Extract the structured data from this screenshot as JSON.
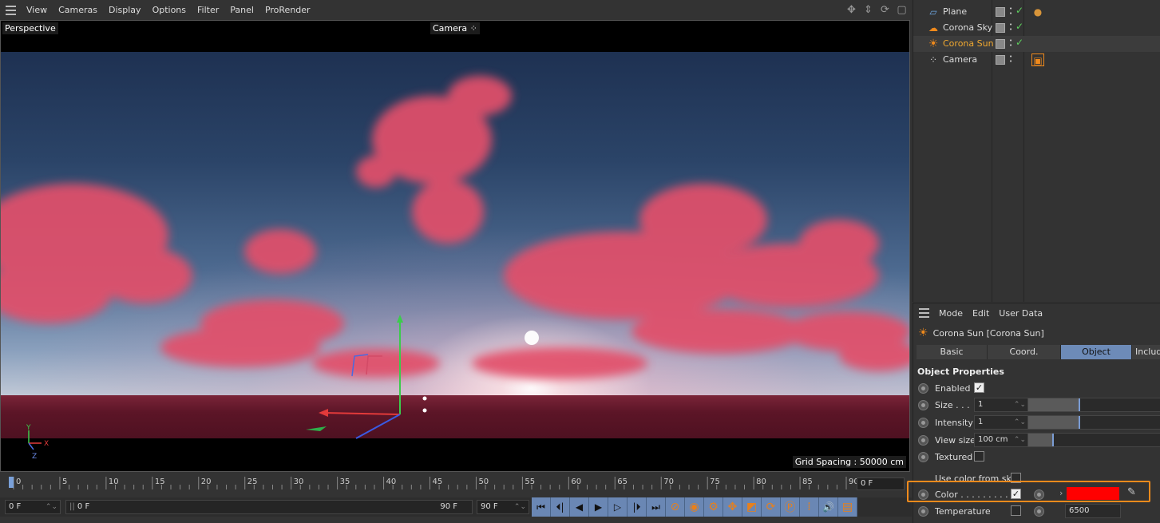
{
  "viewport": {
    "menu": [
      "View",
      "Cameras",
      "Display",
      "Options",
      "Filter",
      "Panel",
      "ProRender"
    ],
    "view_label": "Perspective",
    "camera_label": "Camera",
    "grid_spacing": "Grid Spacing : 50000 cm",
    "axis_labels": {
      "y": "Y",
      "x": "X",
      "z": "Z"
    }
  },
  "timeline": {
    "ticks": [
      "0",
      "5",
      "10",
      "15",
      "20",
      "25",
      "30",
      "35",
      "40",
      "45",
      "50",
      "55",
      "60",
      "65",
      "70",
      "75",
      "80",
      "85",
      "90"
    ],
    "current_frame": "0 F",
    "start_frame": "0 F",
    "range_start": "0 F",
    "range_end": "90 F",
    "end_frame": "90 F"
  },
  "object_manager": {
    "objects": [
      {
        "name": "Plane",
        "icon": "plane-icon",
        "selected": false
      },
      {
        "name": "Corona Sky",
        "icon": "sky-icon",
        "selected": false
      },
      {
        "name": "Corona Sun",
        "icon": "sun-icon",
        "selected": true
      },
      {
        "name": "Camera",
        "icon": "camera-icon",
        "selected": false
      }
    ]
  },
  "attribute_manager": {
    "menu": [
      "Mode",
      "Edit",
      "User Data"
    ],
    "title": "Corona Sun [Corona Sun]",
    "tabs": [
      "Basic",
      "Coord.",
      "Object",
      "Includ"
    ],
    "active_tab": "Object",
    "section": "Object Properties",
    "props": {
      "enabled": {
        "label": "Enabled",
        "checked": true
      },
      "size": {
        "label": "Size . . .",
        "value": "1",
        "slider": 0.38
      },
      "intensity": {
        "label": "Intensity",
        "value": "1",
        "slider": 0.38
      },
      "view_size": {
        "label": "View size",
        "value": "100 cm",
        "slider": 0.18
      },
      "textured": {
        "label": "Textured",
        "checked": false
      },
      "use_color_from_sky": {
        "label": "Use color from sky",
        "checked": false
      },
      "color": {
        "label": "Color . . . . . . . . .",
        "checked": true,
        "swatch": "#ff0000"
      },
      "temperature": {
        "label": "Temperature",
        "value": "6500"
      }
    }
  },
  "colors": {
    "accent": "#6d8bb8",
    "highlight": "#f08a1c",
    "selected_text": "#f0a830"
  }
}
